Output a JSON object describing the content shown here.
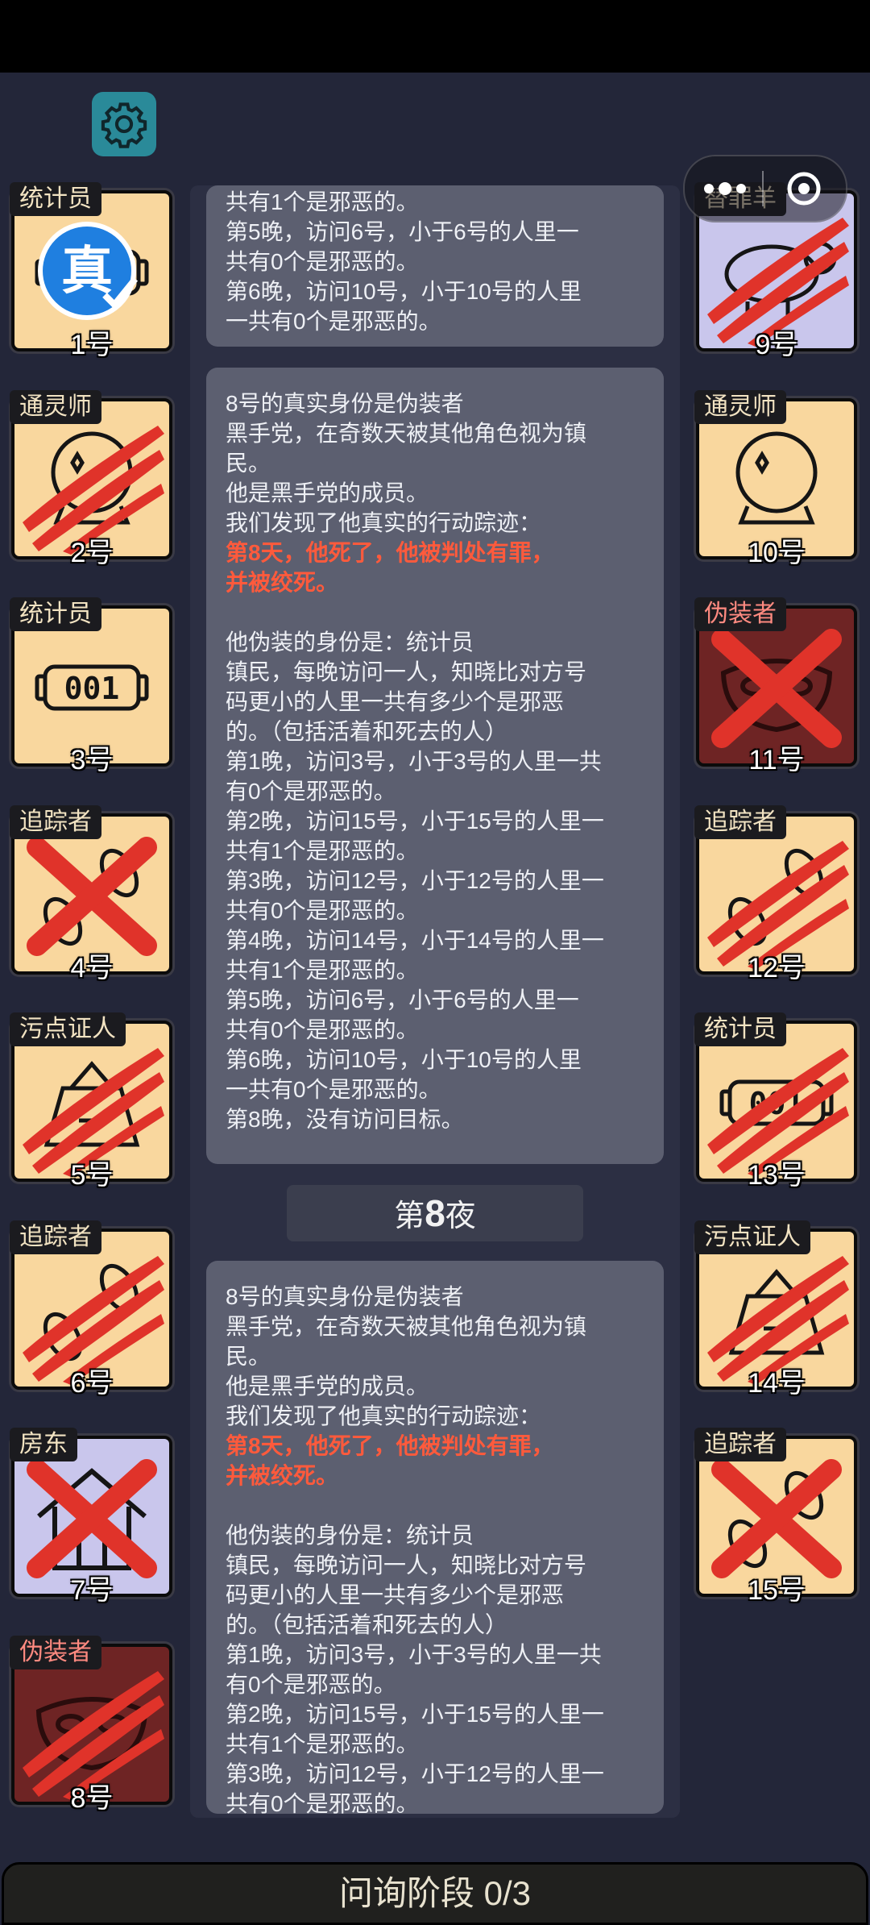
{
  "players_left": [
    {
      "role": "统计员",
      "number": "1号",
      "bg": "#f9d79e",
      "status": "true-badge",
      "evil": false,
      "icon": "counter-icon"
    },
    {
      "role": "通灵师",
      "number": "2号",
      "bg": "#f9d79e",
      "status": "slashed",
      "evil": false,
      "icon": "crystal-ball-icon"
    },
    {
      "role": "统计员",
      "number": "3号",
      "bg": "#f9d79e",
      "status": "alive",
      "evil": false,
      "icon": "counter-icon"
    },
    {
      "role": "追踪者",
      "number": "4号",
      "bg": "#f9d79e",
      "status": "crossed",
      "evil": false,
      "icon": "footprints-icon"
    },
    {
      "role": "污点证人",
      "number": "5号",
      "bg": "#f9d79e",
      "status": "slashed",
      "evil": false,
      "icon": "witness-icon"
    },
    {
      "role": "追踪者",
      "number": "6号",
      "bg": "#f9d79e",
      "status": "slashed",
      "evil": false,
      "icon": "footprints-icon"
    },
    {
      "role": "房东",
      "number": "7号",
      "bg": "#c9c6ec",
      "status": "crossed",
      "evil": false,
      "icon": "house-icon"
    },
    {
      "role": "伪装者",
      "number": "8号",
      "bg": "#6e2424",
      "status": "slashed",
      "evil": true,
      "icon": "mask-icon"
    }
  ],
  "players_right": [
    {
      "role": "替罪羊",
      "number": "9号",
      "bg": "#c9c6ec",
      "status": "slashed",
      "evil": false,
      "icon": "sheep-icon"
    },
    {
      "role": "通灵师",
      "number": "10号",
      "bg": "#f9d79e",
      "status": "alive",
      "evil": false,
      "icon": "crystal-ball-icon"
    },
    {
      "role": "伪装者",
      "number": "11号",
      "bg": "#6e2424",
      "status": "crossed",
      "evil": true,
      "icon": "mask-icon"
    },
    {
      "role": "追踪者",
      "number": "12号",
      "bg": "#f9d79e",
      "status": "slashed",
      "evil": false,
      "icon": "footprints-icon"
    },
    {
      "role": "统计员",
      "number": "13号",
      "bg": "#f9d79e",
      "status": "slashed",
      "evil": false,
      "icon": "counter-icon"
    },
    {
      "role": "污点证人",
      "number": "14号",
      "bg": "#f9d79e",
      "status": "slashed",
      "evil": false,
      "icon": "witness-icon"
    },
    {
      "role": "追踪者",
      "number": "15号",
      "bg": "#f9d79e",
      "status": "crossed",
      "evil": false,
      "icon": "footprints-icon"
    }
  ],
  "true_badge_text": "真",
  "counter_digits": "001",
  "log_panel_top": [
    "共有1个是邪恶的。",
    "第5晚，访问6号，小于6号的人里一",
    "共有0个是邪恶的。",
    "第6晚，访问10号，小于10号的人里",
    "一共有0个是邪恶的。"
  ],
  "log_panel_main": {
    "intro": [
      "8号的真实身份是伪装者",
      "黑手党，在奇数天被其他角色视为镇",
      "民。",
      "他是黑手党的成员。",
      "我们发现了他真实的行动踪迹："
    ],
    "highlight": [
      "第8天，他死了，他被判处有罪，",
      "并被绞死。"
    ],
    "details": [
      "他伪装的身份是：统计员",
      "镇民，每晚访问一人，知晓比对方号",
      "码更小的人里一共有多少个是邪恶",
      "的。（包括活着和死去的人）",
      "第1晚，访问3号，小于3号的人里一共",
      "有0个是邪恶的。",
      "第2晚，访问15号，小于15号的人里一",
      "共有1个是邪恶的。",
      "第3晚，访问12号，小于12号的人里一",
      "共有0个是邪恶的。",
      "第4晚，访问14号，小于14号的人里一",
      "共有1个是邪恶的。",
      "第5晚，访问6号，小于6号的人里一",
      "共有0个是邪恶的。",
      "第6晚，访问10号，小于10号的人里",
      "一共有0个是邪恶的。",
      "第8晚，没有访问目标。"
    ]
  },
  "night_header": {
    "prefix": "第",
    "number": "8",
    "suffix": "夜"
  },
  "log_panel_bottom": {
    "intro": [
      "8号的真实身份是伪装者",
      "黑手党，在奇数天被其他角色视为镇",
      "民。",
      "他是黑手党的成员。",
      "我们发现了他真实的行动踪迹："
    ],
    "highlight": [
      "第8天，他死了，他被判处有罪，",
      "并被绞死。"
    ],
    "details": [
      "他伪装的身份是：统计员",
      "镇民，每晚访问一人，知晓比对方号",
      "码更小的人里一共有多少个是邪恶",
      "的。（包括活着和死去的人）",
      "第1晚，访问3号，小于3号的人里一共",
      "有0个是邪恶的。",
      "第2晚，访问15号，小于15号的人里一",
      "共有1个是邪恶的。",
      "第3晚，访问12号，小于12号的人里一",
      "共有0个是邪恶的。"
    ]
  },
  "bottom_bar": {
    "label": "问询阶段 0/3"
  },
  "colors": {
    "background": "#232639",
    "panel": "#5c5f70",
    "highlight": "#ff5a3c",
    "slash": "#e0332a"
  }
}
